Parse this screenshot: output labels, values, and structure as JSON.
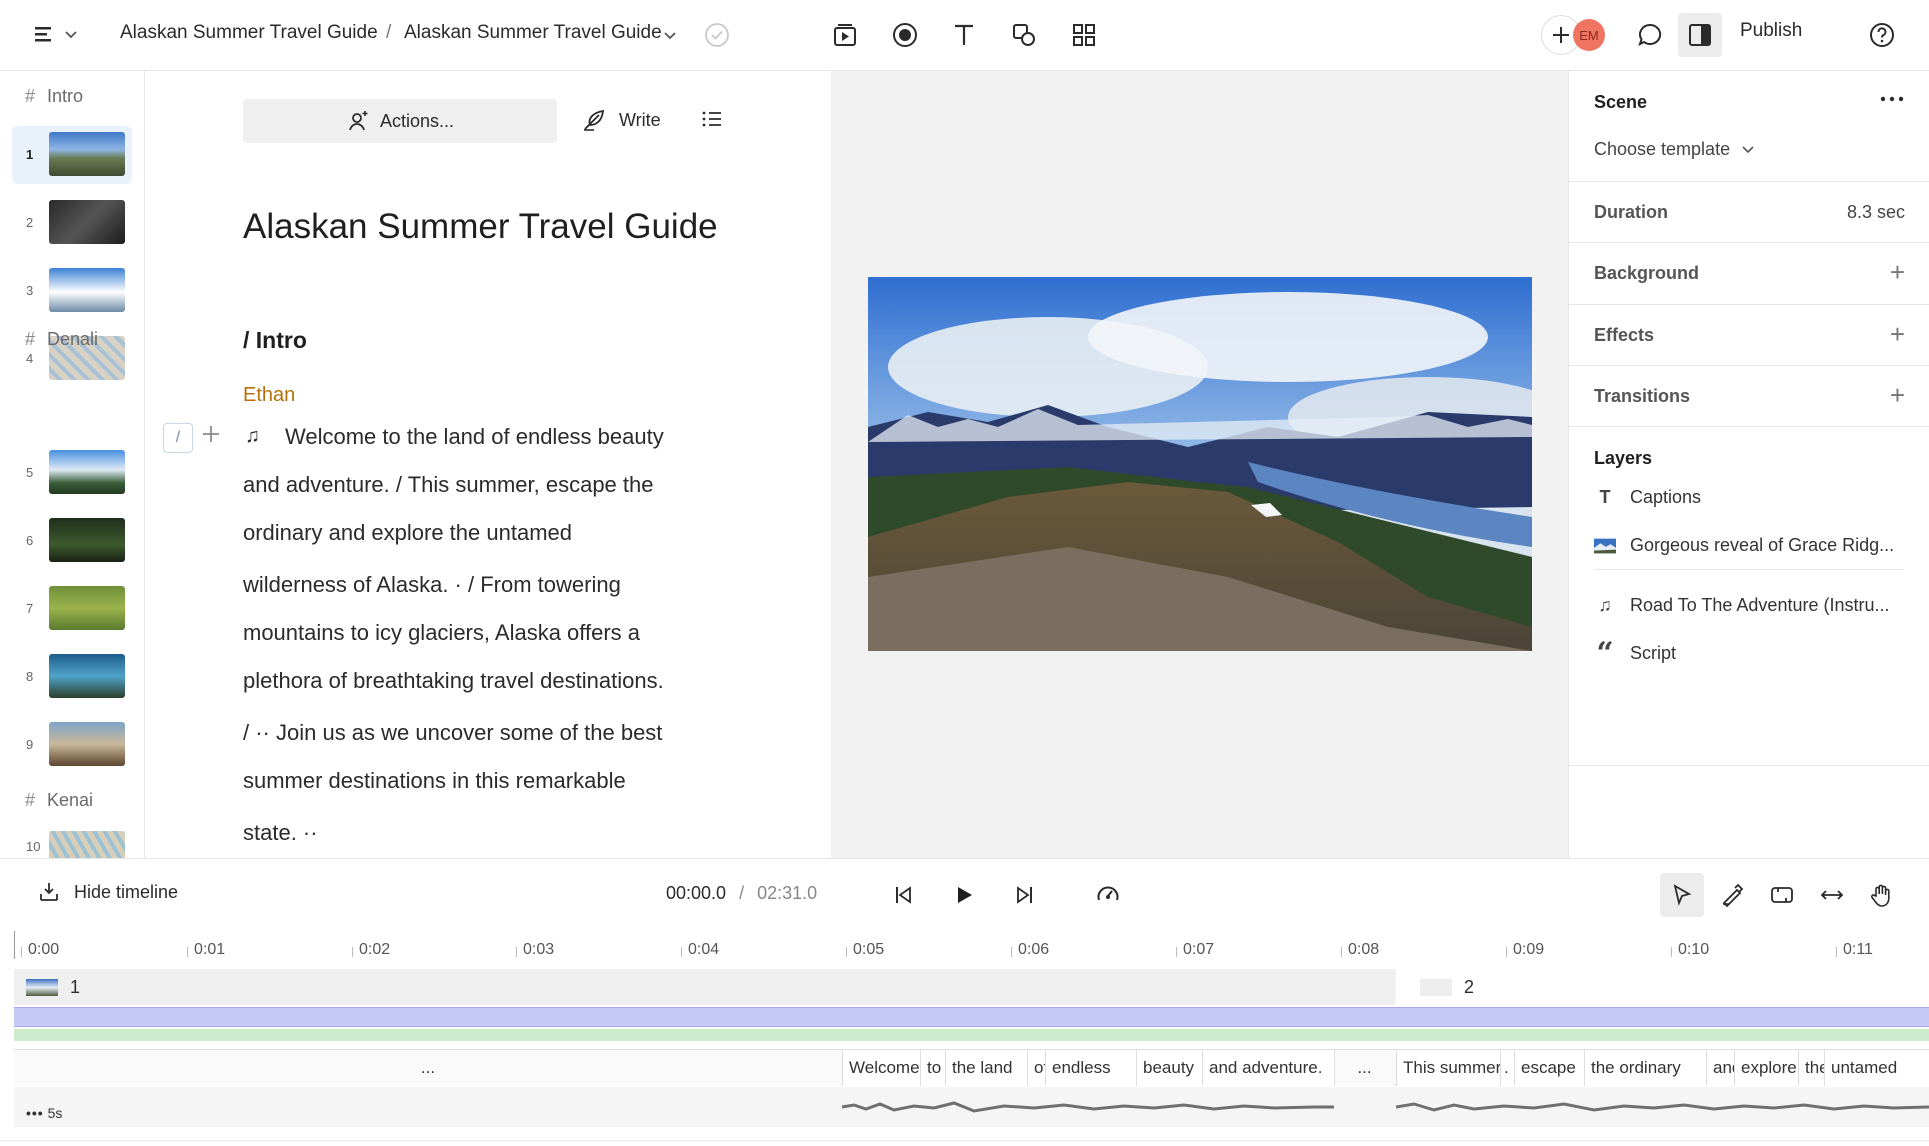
{
  "breadcrumb": {
    "project": "Alaskan Summer Travel Guide",
    "separator": "/",
    "document": "Alaskan Summer Travel Guide"
  },
  "toolbar": {
    "icons": [
      "scene-icon",
      "record-icon",
      "text-icon",
      "shapes-icon",
      "grid-icon"
    ],
    "avatar_initials": "EM",
    "publish_label": "Publish"
  },
  "scene_list": {
    "sections": [
      {
        "title": "Intro",
        "scenes": [
          "1",
          "2",
          "3",
          "4"
        ]
      },
      {
        "title": "Denali",
        "scenes": [
          "5",
          "6",
          "7",
          "8",
          "9"
        ]
      },
      {
        "title": "Kenai",
        "scenes": [
          "10"
        ]
      }
    ],
    "hash": "#",
    "active_scene": "1"
  },
  "editor": {
    "actions_label": "Actions...",
    "write_label": "Write",
    "title": "Alaskan Summer Travel Guide",
    "section_title": "/ Intro",
    "speaker": "Ethan",
    "slash": "/",
    "lines": [
      "Welcome to the land of endless beauty",
      "and adventure. / This summer, escape the",
      "ordinary and explore the untamed",
      "wilderness of Alaska. · / From towering",
      "mountains to icy glaciers, Alaska offers a",
      "plethora of breathtaking travel destinations.",
      "/ ·· Join us as we uncover some of the best",
      "summer destinations in this remarkable",
      "state. ··"
    ]
  },
  "properties": {
    "scene_label": "Scene",
    "template_label": "Choose template",
    "duration_label": "Duration",
    "duration_value": "8.3 sec",
    "background_label": "Background",
    "effects_label": "Effects",
    "transitions_label": "Transitions",
    "layers_label": "Layers",
    "layers": [
      {
        "icon": "T",
        "name": "Captions"
      },
      {
        "icon": "image",
        "name": "Gorgeous reveal of Grace Ridg..."
      },
      {
        "icon": "♫",
        "name": "Road To The Adventure (Instru..."
      },
      {
        "icon": "“",
        "name": "Script"
      }
    ]
  },
  "timeline": {
    "hide_label": "Hide timeline",
    "current_time": "00:00.0",
    "separator": "/",
    "total_time": "02:31.0",
    "ticks": [
      "0:00",
      "0:01",
      "0:02",
      "0:03",
      "0:04",
      "0:05",
      "0:06",
      "0:07",
      "0:08",
      "0:09",
      "0:10",
      "0:11"
    ],
    "scene_clips": [
      "1",
      "2"
    ],
    "words_scene1": [
      "...",
      "Welcome",
      "to",
      "the land",
      "of",
      "endless",
      "beauty",
      "and adventure.",
      "..."
    ],
    "words_scene2": [
      "This summer",
      ".",
      "escape",
      "the ordinary",
      "and",
      "explore",
      "the",
      "untamed"
    ],
    "scale_label": "5s"
  }
}
